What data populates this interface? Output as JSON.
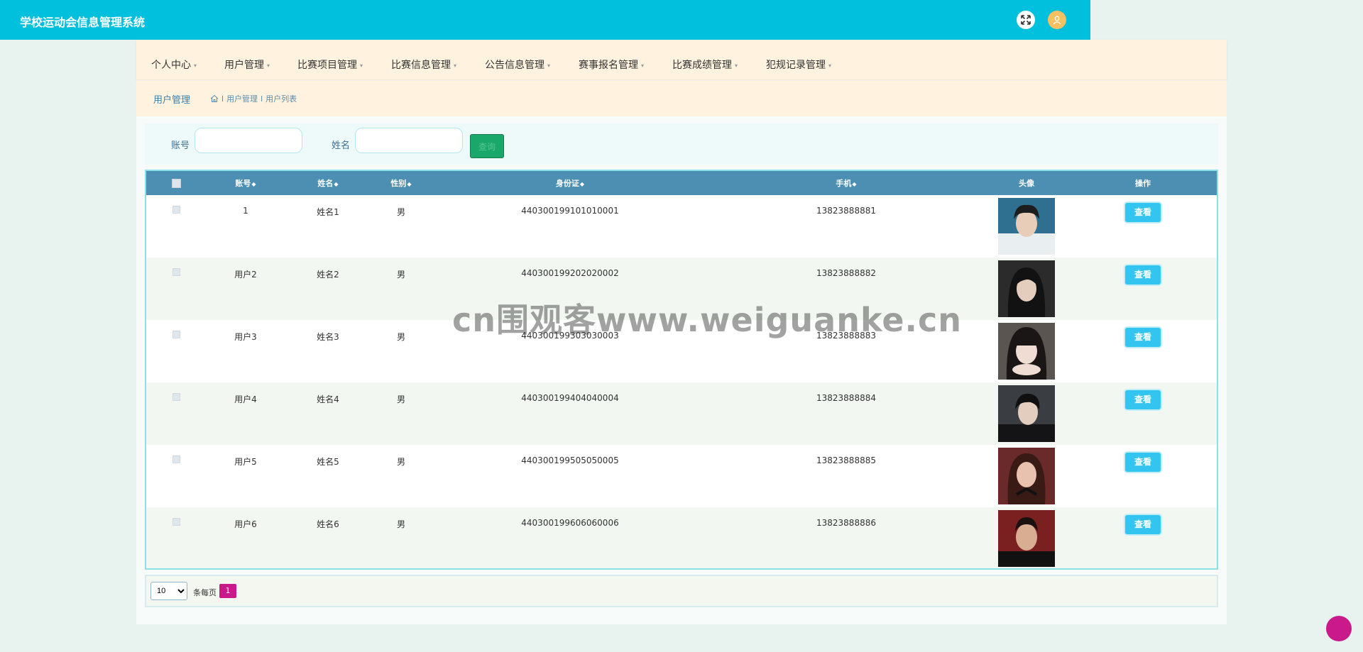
{
  "app": {
    "title": "学校运动会信息管理系统"
  },
  "nav": {
    "items": [
      {
        "label": "个人中心"
      },
      {
        "label": "用户管理"
      },
      {
        "label": "比赛项目管理"
      },
      {
        "label": "比赛信息管理"
      },
      {
        "label": "公告信息管理"
      },
      {
        "label": "赛事报名管理"
      },
      {
        "label": "比赛成绩管理"
      },
      {
        "label": "犯规记录管理"
      }
    ],
    "caret": "▾"
  },
  "breadcrumb": {
    "title": "用户管理",
    "sep": "l",
    "items": [
      "用户管理",
      "用户列表"
    ]
  },
  "search": {
    "account_label": "账号",
    "account_value": "",
    "name_label": "姓名",
    "name_value": "",
    "button_label": "查询"
  },
  "table": {
    "headers": {
      "account": "账号",
      "name": "姓名",
      "gender": "性别",
      "id_card": "身份证",
      "phone": "手机",
      "avatar": "头像",
      "action": "操作"
    },
    "sort_icon": "◆",
    "action_label": "查看",
    "rows": [
      {
        "account": "1",
        "name": "姓名1",
        "gender": "男",
        "id_card": "440300199101010001",
        "phone": "13823888881"
      },
      {
        "account": "用户2",
        "name": "姓名2",
        "gender": "男",
        "id_card": "440300199202020002",
        "phone": "13823888882"
      },
      {
        "account": "用户3",
        "name": "姓名3",
        "gender": "男",
        "id_card": "440300199303030003",
        "phone": "13823888883"
      },
      {
        "account": "用户4",
        "name": "姓名4",
        "gender": "男",
        "id_card": "440300199404040004",
        "phone": "13823888884"
      },
      {
        "account": "用户5",
        "name": "姓名5",
        "gender": "男",
        "id_card": "440300199505050005",
        "phone": "13823888885"
      },
      {
        "account": "用户6",
        "name": "姓名6",
        "gender": "男",
        "id_card": "440300199606060006",
        "phone": "13823888886"
      }
    ]
  },
  "pagination": {
    "page_size_options": [
      "10"
    ],
    "page_size": "10",
    "per_page_label": "条每页",
    "current_page": "1"
  },
  "watermark": "cn围观客www.weiguanke.cn",
  "colors": {
    "topbar": "#00c0dd",
    "table_header": "#4c8fb2",
    "view_button": "#33c4ef",
    "page_active": "#c9198a",
    "search_button": "#19a76a"
  }
}
